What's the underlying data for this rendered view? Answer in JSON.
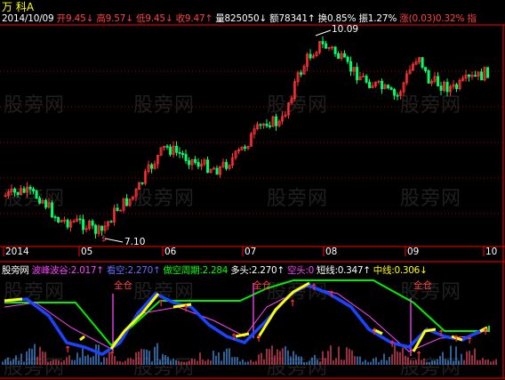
{
  "header": {
    "stock": "万 科A",
    "date": "2014/10/09",
    "open_label": "开",
    "open": "9.45↓",
    "high_label": "高",
    "high": "9.57↓",
    "low_label": "低",
    "low": "9.45↓",
    "close_label": "收",
    "close": "9.47↑",
    "vol_label": "量",
    "vol": "825050↓",
    "amt_label": "额",
    "amt": "78341↑",
    "turn_label": "换",
    "turn": "0.85%",
    "amp_label": "振",
    "amp": "1.27%",
    "chg_label": "涨",
    "chg": "(0.03)0.32%",
    "idx_label": "指"
  },
  "price_annotations": {
    "high": "10.09",
    "low": "7.10"
  },
  "x_axis": {
    "labels": [
      "2014",
      "05",
      "06",
      "07",
      "08",
      "09",
      "10"
    ]
  },
  "indicator_bar": {
    "name": "股旁网",
    "wave_label": "波峰波谷:",
    "wave_value": "2.017↑",
    "short_label": "看空:",
    "short_value": "2.270↑",
    "cycle_label": "做空周期:",
    "cycle_value": "2.284",
    "long_label": "多头:",
    "long_value": "2.270↑",
    "empty_label": "空头:",
    "empty_value": "0",
    "shortline_label": "短线:",
    "shortline_value": "0.347↑",
    "midline_label": "中线:",
    "midline_value": "0.306↓"
  },
  "signals": {
    "full": "全仓"
  },
  "watermark": "股旁网",
  "colors": {
    "up": "#ff3030",
    "down": "#00ff66",
    "grid": "#ff0000",
    "yellow": "#ffff00",
    "blue": "#1a44ff",
    "green": "#00ee00",
    "magenta": "#ff44ff"
  },
  "chart_data": {
    "type": "candlestick",
    "price_annotations": {
      "high": 10.09,
      "low": 7.1
    },
    "x_ticks": [
      "2014",
      "05",
      "06",
      "07",
      "08",
      "09",
      "10"
    ]
  }
}
